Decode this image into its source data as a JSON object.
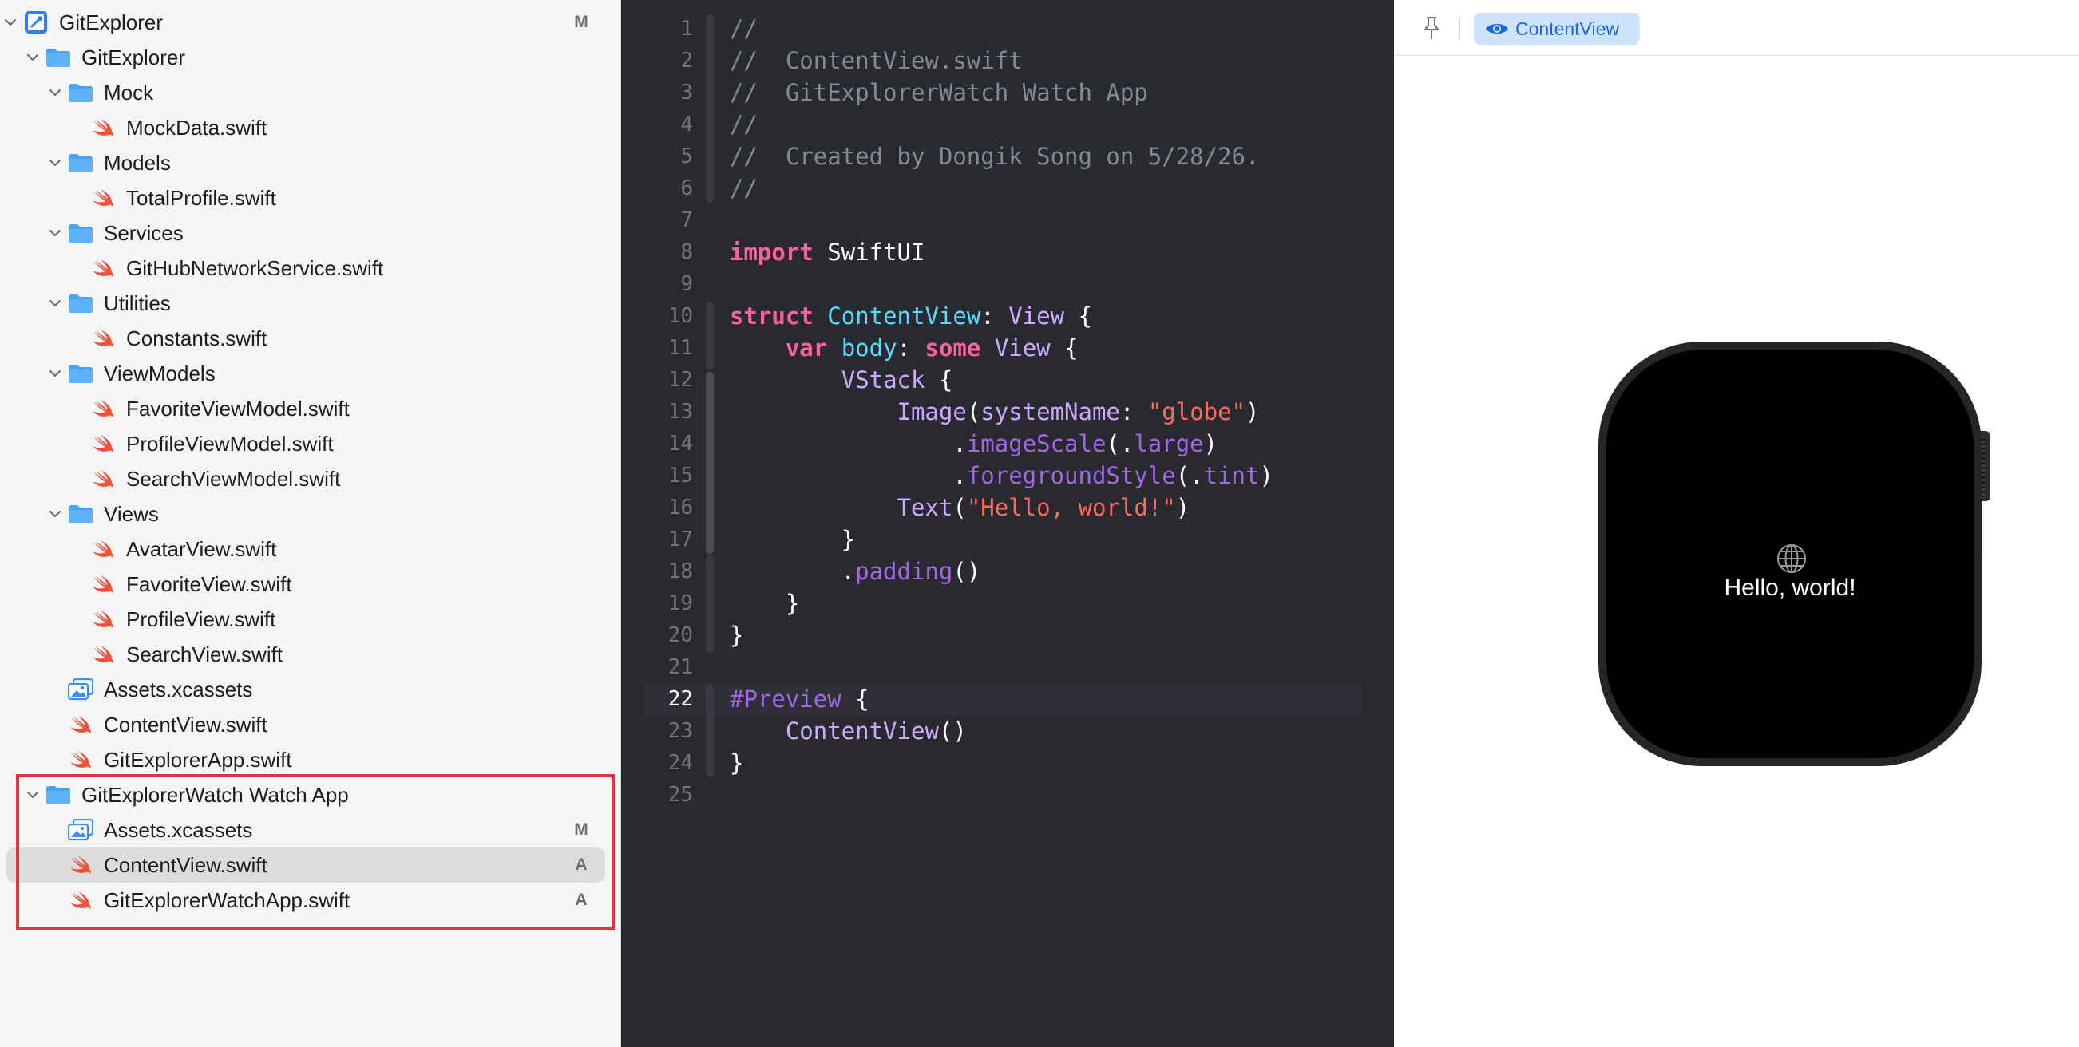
{
  "navigator": {
    "items": [
      {
        "label": "GitExplorer",
        "kind": "project",
        "indent": 0,
        "expanded": true,
        "badge": "M"
      },
      {
        "label": "GitExplorer",
        "kind": "folder",
        "indent": 1,
        "expanded": true,
        "badge": ""
      },
      {
        "label": "Mock",
        "kind": "folder",
        "indent": 2,
        "expanded": true,
        "badge": ""
      },
      {
        "label": "MockData.swift",
        "kind": "swift",
        "indent": 3,
        "badge": ""
      },
      {
        "label": "Models",
        "kind": "folder",
        "indent": 2,
        "expanded": true,
        "badge": ""
      },
      {
        "label": "TotalProfile.swift",
        "kind": "swift",
        "indent": 3,
        "badge": ""
      },
      {
        "label": "Services",
        "kind": "folder",
        "indent": 2,
        "expanded": true,
        "badge": ""
      },
      {
        "label": "GitHubNetworkService.swift",
        "kind": "swift",
        "indent": 3,
        "badge": ""
      },
      {
        "label": "Utilities",
        "kind": "folder",
        "indent": 2,
        "expanded": true,
        "badge": ""
      },
      {
        "label": "Constants.swift",
        "kind": "swift",
        "indent": 3,
        "badge": ""
      },
      {
        "label": "ViewModels",
        "kind": "folder",
        "indent": 2,
        "expanded": true,
        "badge": ""
      },
      {
        "label": "FavoriteViewModel.swift",
        "kind": "swift",
        "indent": 3,
        "badge": ""
      },
      {
        "label": "ProfileViewModel.swift",
        "kind": "swift",
        "indent": 3,
        "badge": ""
      },
      {
        "label": "SearchViewModel.swift",
        "kind": "swift",
        "indent": 3,
        "badge": ""
      },
      {
        "label": "Views",
        "kind": "folder",
        "indent": 2,
        "expanded": true,
        "badge": ""
      },
      {
        "label": "AvatarView.swift",
        "kind": "swift",
        "indent": 3,
        "badge": ""
      },
      {
        "label": "FavoriteView.swift",
        "kind": "swift",
        "indent": 3,
        "badge": ""
      },
      {
        "label": "ProfileView.swift",
        "kind": "swift",
        "indent": 3,
        "badge": ""
      },
      {
        "label": "SearchView.swift",
        "kind": "swift",
        "indent": 3,
        "badge": ""
      },
      {
        "label": "Assets.xcassets",
        "kind": "assets",
        "indent": 2,
        "badge": ""
      },
      {
        "label": "ContentView.swift",
        "kind": "swift",
        "indent": 2,
        "badge": ""
      },
      {
        "label": "GitExplorerApp.swift",
        "kind": "swift",
        "indent": 2,
        "badge": ""
      },
      {
        "label": "GitExplorerWatch Watch App",
        "kind": "folder",
        "indent": 1,
        "expanded": true,
        "badge": ""
      },
      {
        "label": "Assets.xcassets",
        "kind": "assets",
        "indent": 2,
        "badge": "M"
      },
      {
        "label": "ContentView.swift",
        "kind": "swift",
        "indent": 2,
        "badge": "A",
        "selected": true
      },
      {
        "label": "GitExplorerWatchApp.swift",
        "kind": "swift",
        "indent": 2,
        "badge": "A"
      }
    ]
  },
  "editor": {
    "current_line": 22,
    "lines": [
      [
        [
          "//",
          "comment"
        ]
      ],
      [
        [
          "//  ContentView.swift",
          "comment"
        ]
      ],
      [
        [
          "//  GitExplorerWatch Watch App",
          "comment"
        ]
      ],
      [
        [
          "//",
          "comment"
        ]
      ],
      [
        [
          "//  Created by Dongik Song on 5/28/26.",
          "comment"
        ]
      ],
      [
        [
          "//",
          "comment"
        ]
      ],
      [],
      [
        [
          "import",
          "kw"
        ],
        [
          " SwiftUI",
          "plain"
        ]
      ],
      [],
      [
        [
          "struct",
          "kw"
        ],
        [
          " ",
          "plain"
        ],
        [
          "ContentView",
          "decl"
        ],
        [
          ": ",
          "plain"
        ],
        [
          "View",
          "type"
        ],
        [
          " {",
          "plain"
        ]
      ],
      [
        [
          "    ",
          "plain"
        ],
        [
          "var",
          "kw"
        ],
        [
          " ",
          "plain"
        ],
        [
          "body",
          "decl"
        ],
        [
          ": ",
          "plain"
        ],
        [
          "some",
          "kw"
        ],
        [
          " ",
          "plain"
        ],
        [
          "View",
          "type"
        ],
        [
          " {",
          "plain"
        ]
      ],
      [
        [
          "        ",
          "plain"
        ],
        [
          "VStack",
          "type"
        ],
        [
          " {",
          "plain"
        ]
      ],
      [
        [
          "            ",
          "plain"
        ],
        [
          "Image",
          "type"
        ],
        [
          "(",
          "plain"
        ],
        [
          "systemName",
          "type"
        ],
        [
          ": ",
          "plain"
        ],
        [
          "\"globe\"",
          "string"
        ],
        [
          ")",
          "plain"
        ]
      ],
      [
        [
          "                .",
          "plain"
        ],
        [
          "imageScale",
          "method"
        ],
        [
          "(.",
          "plain"
        ],
        [
          "large",
          "method"
        ],
        [
          ")",
          "plain"
        ]
      ],
      [
        [
          "                .",
          "plain"
        ],
        [
          "foregroundStyle",
          "method"
        ],
        [
          "(.",
          "plain"
        ],
        [
          "tint",
          "method"
        ],
        [
          ")",
          "plain"
        ]
      ],
      [
        [
          "            ",
          "plain"
        ],
        [
          "Text",
          "type"
        ],
        [
          "(",
          "plain"
        ],
        [
          "\"Hello, world!\"",
          "string"
        ],
        [
          ")",
          "plain"
        ]
      ],
      [
        [
          "        }",
          "plain"
        ]
      ],
      [
        [
          "        .",
          "plain"
        ],
        [
          "padding",
          "method"
        ],
        [
          "()",
          "plain"
        ]
      ],
      [
        [
          "    }",
          "plain"
        ]
      ],
      [
        [
          "}",
          "plain"
        ]
      ],
      [],
      [
        [
          "#Preview",
          "attr"
        ],
        [
          " {",
          "plain"
        ]
      ],
      [
        [
          "    ",
          "plain"
        ],
        [
          "ContentView",
          "type"
        ],
        [
          "()",
          "plain"
        ]
      ],
      [
        [
          "}",
          "plain"
        ]
      ],
      []
    ]
  },
  "canvas": {
    "pin_icon": "pin-icon",
    "preview_chip": {
      "icon": "eye-icon",
      "label": "ContentView"
    },
    "watch": {
      "icon": "globe-icon",
      "text": "Hello, world!"
    }
  },
  "colors": {
    "highlight_box": "#e23340",
    "swift_icon": "#f05138",
    "folder_icon": "#4ba3f5",
    "editor_bg": "#292a30",
    "preview_chip_bg": "#cfe3fb",
    "preview_chip_fg": "#1668d9"
  }
}
